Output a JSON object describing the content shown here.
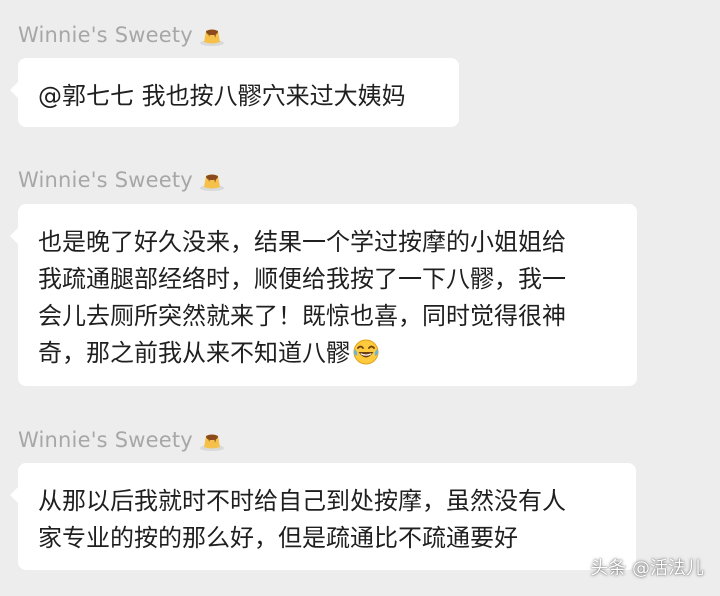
{
  "messages": [
    {
      "sender": "Winnie's Sweety",
      "sender_icon": "pudding-icon",
      "lines": [
        "@郭七七 我也按八髎穴来过大姨妈"
      ]
    },
    {
      "sender": "Winnie's Sweety",
      "sender_icon": "pudding-icon",
      "lines": [
        "也是晚了好久没来，结果一个学过按摩的小姐姐给",
        "我疏通腿部经络时，顺便给我按了一下八髎，我一",
        "会儿去厕所突然就来了！既惊也喜，同时觉得很神",
        "奇，那之前我从来不知道八髎"
      ],
      "trailing_emoji": "laughing-tears-icon"
    },
    {
      "sender": "Winnie's Sweety",
      "sender_icon": "pudding-icon",
      "lines": [
        "从那以后我就时不时给自己到处按摩，虽然没有人",
        "家专业的按的那么好，但是疏通比不疏通要好"
      ]
    }
  ],
  "watermark": "头条 @活法儿",
  "colors": {
    "background": "#ededed",
    "bubble": "#ffffff",
    "sender_text": "#a7a7a7",
    "message_text": "#1f1f1f"
  }
}
